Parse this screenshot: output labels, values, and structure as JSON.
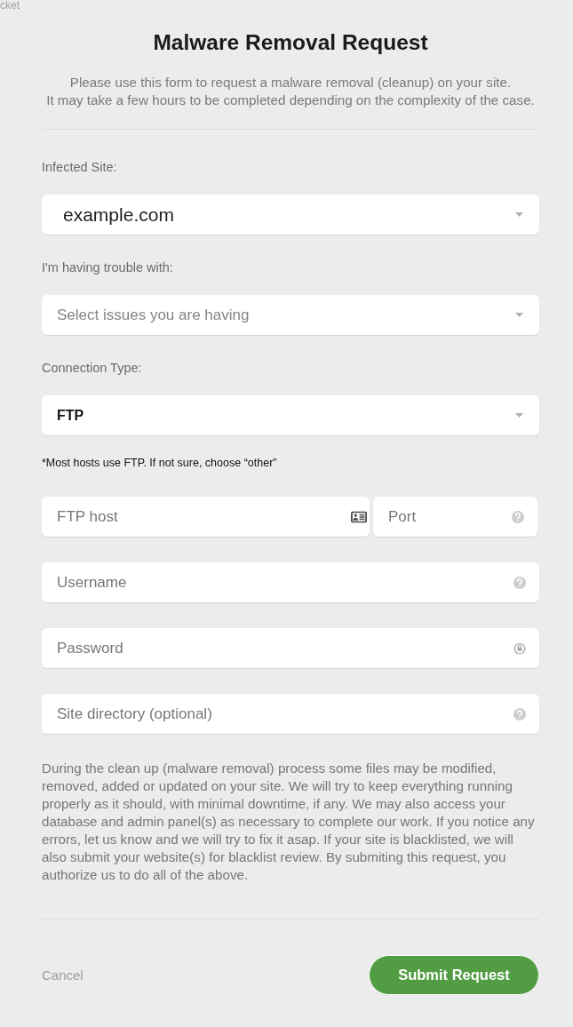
{
  "header": {
    "cut_off_text": "cket",
    "title": "Malware Removal Request",
    "intro": [
      "Please use this form to request a malware removal (cleanup) on your site.",
      "It may take a few hours to be completed depending on the complexity of the case."
    ]
  },
  "infected_site": {
    "label": "Infected Site:",
    "value": "example.com"
  },
  "trouble": {
    "label": "I'm having trouble with:",
    "placeholder": "Select issues you are having"
  },
  "connection_type": {
    "label": "Connection Type:",
    "value": "FTP",
    "note": "*Most hosts use FTP. If not sure, choose “other”"
  },
  "credentials": [
    [
      {
        "kind": "host",
        "placeholder": "FTP host"
      },
      {
        "kind": "port",
        "placeholder": "Port"
      }
    ],
    [
      {
        "kind": "username",
        "placeholder": "Username"
      }
    ],
    [
      {
        "kind": "password",
        "placeholder": "Password"
      }
    ],
    [
      {
        "kind": "directory",
        "placeholder": "Site directory (optional)"
      }
    ]
  ],
  "disclaimer": "During the clean up (malware removal) process some files may be modified, removed, added or updated on your site. We will try to keep everything running properly as it should, with minimal downtime, if any. We may also access your database and admin panel(s) as necessary to complete our work. If you notice any errors, let us know and we will try to fix it asap. If your site is blacklisted, we will also submit your website(s) for blacklist review. By submiting this request, you authorize us to do all of the above.",
  "actions": {
    "cancel": "Cancel",
    "submit": "Submit Request"
  }
}
